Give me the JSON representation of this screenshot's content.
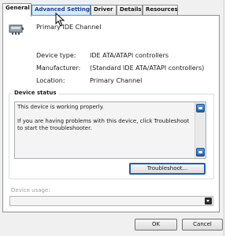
{
  "tabs": [
    {
      "label": "General",
      "active": true
    },
    {
      "label": "Advanced Settings",
      "active": false,
      "hover": true
    },
    {
      "label": "Driver",
      "active": false
    },
    {
      "label": "Details",
      "active": false
    },
    {
      "label": "Resources",
      "active": false
    }
  ],
  "device": {
    "name": "Primary IDE Channel",
    "icon": "ide-controller-icon"
  },
  "properties": [
    {
      "label": "Device type:",
      "value": "IDE ATA/ATAPI controllers"
    },
    {
      "label": "Manufacturer:",
      "value": "(Standard IDE ATA/ATAPI controllers)"
    },
    {
      "label": "Location:",
      "value": "Primary Channel"
    }
  ],
  "status": {
    "title": "Device status",
    "line1": "This device is working properly.",
    "line2": "If you are having problems with this device, click Troubleshoot to start the troubleshooter."
  },
  "buttons": {
    "troubleshoot": "Troubleshoot...",
    "ok": "OK",
    "cancel": "Cancel"
  },
  "usage": {
    "label": "Device usage:",
    "value": ""
  },
  "colors": {
    "accent": "#1d5fae",
    "tab_hover": "#c9e8fa"
  }
}
